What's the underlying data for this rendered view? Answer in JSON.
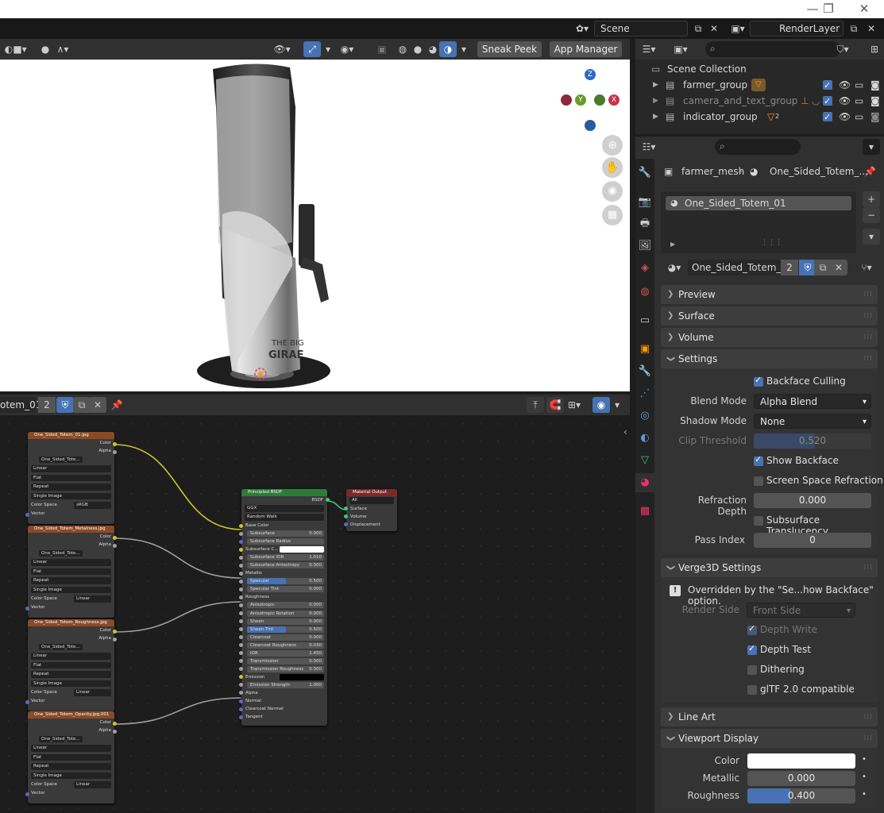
{
  "window": {
    "restore_icon": "restore-icon",
    "close_icon": "close-icon"
  },
  "topbar": {
    "scene_label": "Scene",
    "renderlayer_label": "RenderLayer"
  },
  "viewport_header": {
    "sneak_peek": "Sneak Peek",
    "app_manager": "App Manager"
  },
  "gizmo": {
    "z": "Z",
    "y": "Y",
    "x": "X"
  },
  "node_editor_header": {
    "material_name": "otem_01",
    "user_count": "2"
  },
  "nodes": {
    "tex1": {
      "title": "One_Sided_Totem_01.jpg",
      "image": "One_Sided_Tote...",
      "interp": "Linear",
      "proj": "Flat",
      "ext": "Repeat",
      "source": "Single Image",
      "colorspace_label": "Color Space",
      "colorspace": "sRGB"
    },
    "tex2": {
      "title": "One_Sided_Totem_Metalness.jpg",
      "image": "One_Sided_Tote...",
      "interp": "Linear",
      "proj": "Flat",
      "ext": "Repeat",
      "source": "Single Image",
      "colorspace_label": "Color Space",
      "colorspace": "Linear"
    },
    "tex3": {
      "title": "One_Sided_Totem_Roughness.jpg",
      "image": "One_Sided_Tote...",
      "interp": "Linear",
      "proj": "Flat",
      "ext": "Repeat",
      "source": "Single Image",
      "colorspace_label": "Color Space",
      "colorspace": "Linear"
    },
    "tex4": {
      "title": "One_Sided_Totem_Opacity.jpg.001",
      "image": "One_Sided_Tote...",
      "interp": "Linear",
      "proj": "Flat",
      "ext": "Repeat",
      "source": "Single Image",
      "colorspace_label": "Color Space",
      "colorspace": "Linear"
    },
    "socket_color": "Color",
    "socket_alpha": "Alpha",
    "socket_vector": "Vector",
    "bsdf": {
      "title": "Principled BSDF",
      "out": "BSDF",
      "dist": "GGX",
      "sss": "Random Walk",
      "rows": [
        {
          "label": "Base Color",
          "value": ""
        },
        {
          "label": "Subsurface",
          "value": "0.000"
        },
        {
          "label": "Subsurface Radius",
          "value": ""
        },
        {
          "label": "Subsurface C...",
          "value": ""
        },
        {
          "label": "Subsurface IOR",
          "value": "1.010"
        },
        {
          "label": "Subsurface Anisotropy",
          "value": "0.000"
        },
        {
          "label": "Metallic",
          "value": ""
        },
        {
          "label": "Specular",
          "value": "0.500"
        },
        {
          "label": "Specular Tint",
          "value": "0.000"
        },
        {
          "label": "Roughness",
          "value": ""
        },
        {
          "label": "Anisotropic",
          "value": "0.000"
        },
        {
          "label": "Anisotropic Rotation",
          "value": "0.000"
        },
        {
          "label": "Sheen",
          "value": "0.000"
        },
        {
          "label": "Sheen Tint",
          "value": "0.500"
        },
        {
          "label": "Clearcoat",
          "value": "0.000"
        },
        {
          "label": "Clearcoat Roughness",
          "value": "0.030"
        },
        {
          "label": "IOR",
          "value": "1.450"
        },
        {
          "label": "Transmission",
          "value": "0.000"
        },
        {
          "label": "Transmission Roughness",
          "value": "0.000"
        },
        {
          "label": "Emission",
          "value": ""
        },
        {
          "label": "Emission Strength",
          "value": "1.000"
        },
        {
          "label": "Alpha",
          "value": ""
        },
        {
          "label": "Normal",
          "value": ""
        },
        {
          "label": "Clearcoat Normal",
          "value": ""
        },
        {
          "label": "Tangent",
          "value": ""
        }
      ]
    },
    "output": {
      "title": "Material Output",
      "target": "All",
      "surface": "Surface",
      "volume": "Volume",
      "displacement": "Displacement"
    }
  },
  "outliner": {
    "root": "Scene Collection",
    "items": [
      {
        "label": "farmer_group"
      },
      {
        "label": "camera_and_text_group"
      },
      {
        "label": "indicator_group",
        "badge": "2"
      }
    ]
  },
  "properties": {
    "breadcrumb_object": "farmer_mesh",
    "breadcrumb_material": "One_Sided_Totem_...",
    "slot_name": "One_Sided_Totem_01",
    "material_name": "One_Sided_Totem_01",
    "material_users": "2",
    "panels": {
      "preview": "Preview",
      "surface": "Surface",
      "volume": "Volume",
      "settings": "Settings",
      "verge3d": "Verge3D Settings",
      "line_art": "Line Art",
      "viewport_display": "Viewport Display"
    },
    "settings": {
      "backface_culling": "Backface Culling",
      "blend_mode_label": "Blend Mode",
      "blend_mode": "Alpha Blend",
      "shadow_mode_label": "Shadow Mode",
      "shadow_mode": "None",
      "clip_threshold_label": "Clip Threshold",
      "clip_threshold": "0.520",
      "show_backface": "Show Backface",
      "ssr": "Screen Space Refraction",
      "refraction_depth_label": "Refraction Depth",
      "refraction_depth": "0.000",
      "subsurface_translucency": "Subsurface Translucency",
      "pass_index_label": "Pass Index",
      "pass_index": "0"
    },
    "verge3d": {
      "info": "Overridden by the \"Se...how Backface\" option.",
      "render_side_label": "Render Side",
      "render_side": "Front Side",
      "depth_write": "Depth Write",
      "depth_test": "Depth Test",
      "dithering": "Dithering",
      "gltf": "glTF 2.0 compatible"
    },
    "viewport_display": {
      "color_label": "Color",
      "metallic_label": "Metallic",
      "metallic": "0.000",
      "roughness_label": "Roughness",
      "roughness": "0.400"
    }
  },
  "accent": "#4772b3"
}
